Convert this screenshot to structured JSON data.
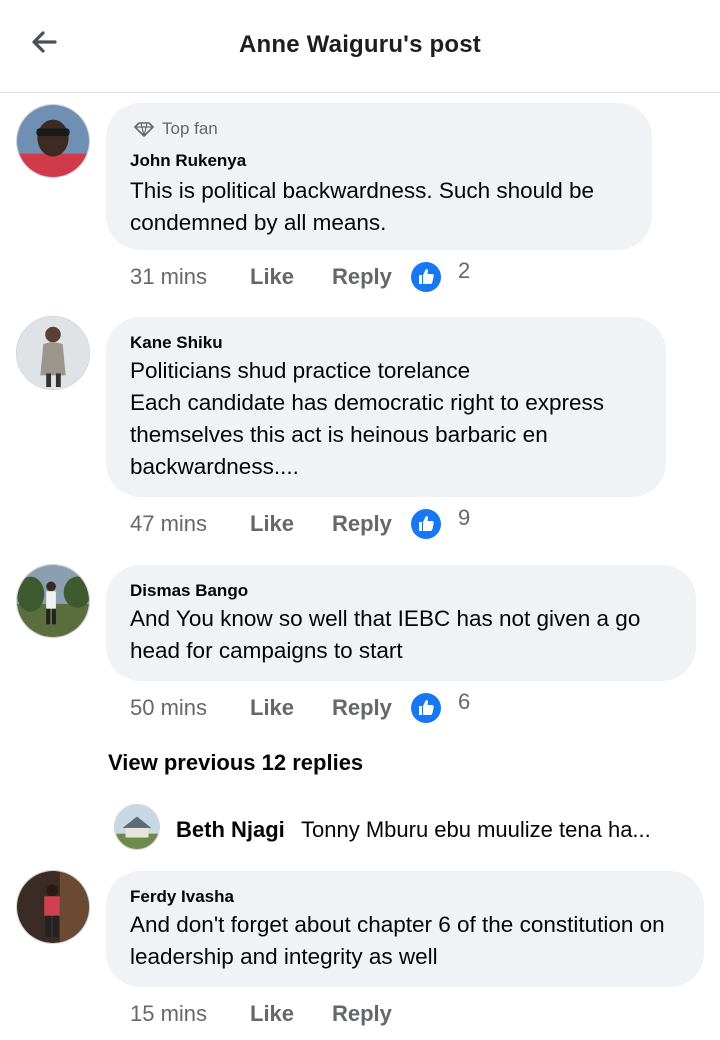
{
  "header": {
    "title": "Anne Waiguru's post"
  },
  "comments": [
    {
      "author": "John Rukenya",
      "badge": "Top fan",
      "text": "This is political backwardness. Such should be condemned by all means.",
      "time": "31 mins",
      "like_label": "Like",
      "reply_label": "Reply",
      "reaction_count": "2",
      "avatar_icon": "person-avatar"
    },
    {
      "author": "Kane Shiku",
      "text": "Politicians shud practice torelance\nEach candidate has democratic right to express themselves this act is heinous barbaric en backwardness....",
      "time": "47 mins",
      "like_label": "Like",
      "reply_label": "Reply",
      "reaction_count": "9",
      "avatar_icon": "person-avatar"
    },
    {
      "author": "Dismas Bango",
      "text": "And You know so well that IEBC has not given a go head for campaigns to start",
      "time": "50 mins",
      "like_label": "Like",
      "reply_label": "Reply",
      "reaction_count": "6",
      "avatar_icon": "person-avatar"
    },
    {
      "author": "Ferdy Ivasha",
      "text": "And don't forget about chapter 6 of the constitution on leadership and integrity as well",
      "time": "15 mins",
      "like_label": "Like",
      "reply_label": "Reply",
      "avatar_icon": "person-avatar"
    }
  ],
  "view_previous": "View previous 12 replies",
  "reply_preview": {
    "author": "Beth Njagi",
    "text": "Tonny Mburu ebu muulize tena ha..."
  },
  "colors": {
    "bubble": "#f0f2f5",
    "secondary_text": "#65676b",
    "like_blue": "#1877f2"
  }
}
